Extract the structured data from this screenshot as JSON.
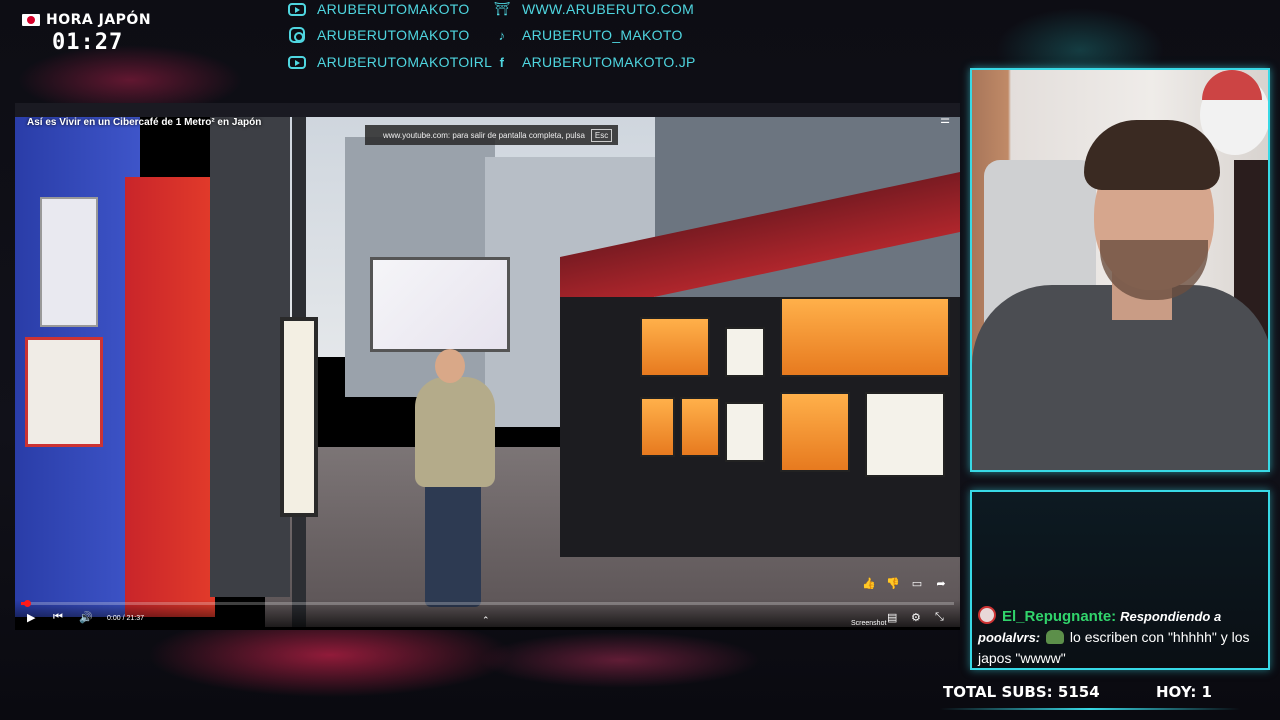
{
  "clock": {
    "label": "HORA JAPÓN",
    "time": "01:27"
  },
  "socials": {
    "left": [
      {
        "icon": "youtube-icon",
        "text": "ARUBERUTOMAKOTO"
      },
      {
        "icon": "instagram-icon",
        "text": "ARUBERUTOMAKOTO"
      },
      {
        "icon": "youtube-icon",
        "text": "ARUBERUTOMAKOTOIRL"
      }
    ],
    "right": [
      {
        "icon": "torii-gate-icon",
        "text": "WWW.ARUBERUTO.COM"
      },
      {
        "icon": "tiktok-icon",
        "text": "ARUBERUTO_MAKOTO"
      },
      {
        "icon": "facebook-icon",
        "text": "ARUBERUTOMAKOTO.JP"
      }
    ]
  },
  "player": {
    "title": "Así es Vivir en un Cibercafé de 1 Metro² en Japón",
    "fullscreen_toast": "www.youtube.com: para salir de pantalla completa, pulsa",
    "esc_key": "Esc",
    "time": "0:00 / 21:37",
    "progress": 0.006,
    "screenshot_label": "Screenshot",
    "accent": "#ff1a1a"
  },
  "chat": {
    "user": "El_Repugnante:",
    "reply_prefix": "Respondiendo a poolalvrs:",
    "message": "lo escriben con \"hhhhh\" y los japos \"wwww\""
  },
  "stats": {
    "total_subs": "TOTAL SUBS: 5154",
    "today": "HOY: 1"
  },
  "colors": {
    "cyan": "#38d9e6",
    "social": "#4fd6e0",
    "chat_user": "#31d46b"
  }
}
